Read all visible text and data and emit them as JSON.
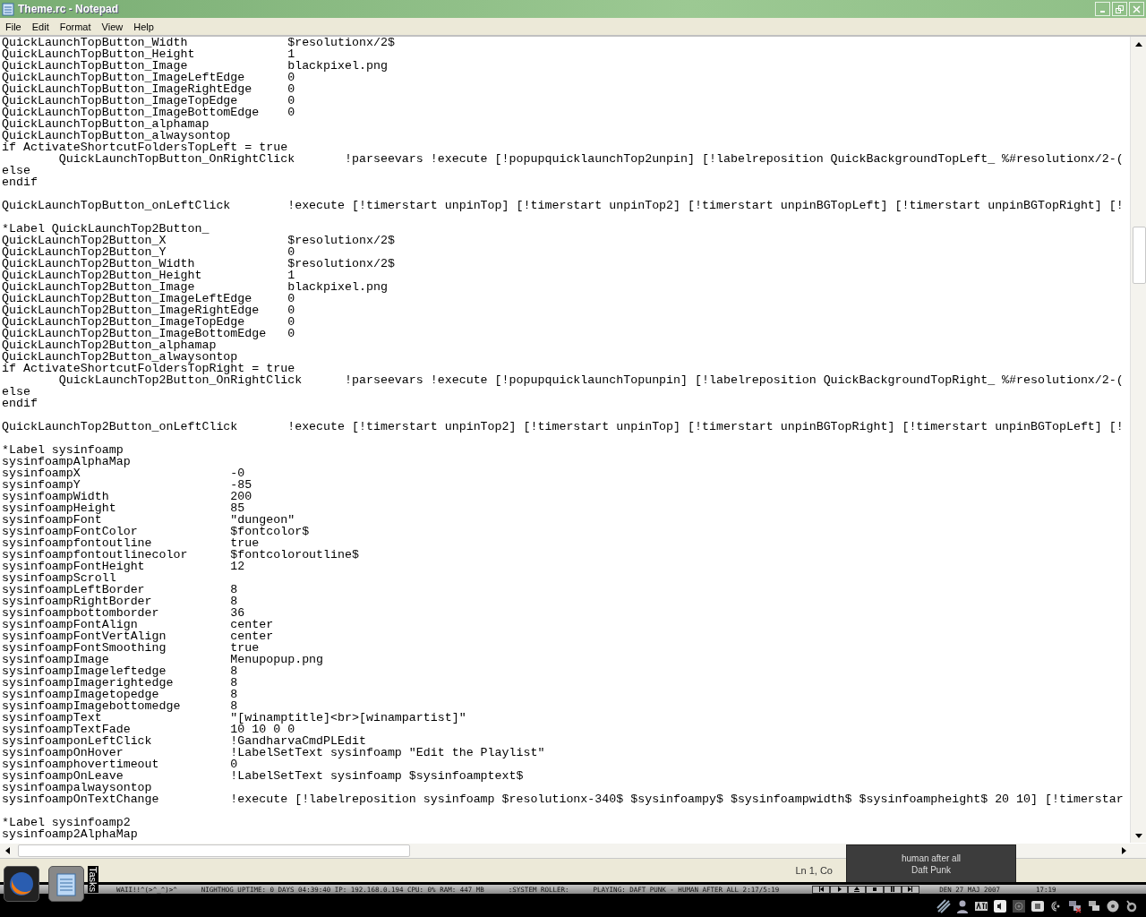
{
  "window": {
    "title": "Theme.rc - Notepad"
  },
  "menu": [
    "File",
    "Edit",
    "Format",
    "View",
    "Help"
  ],
  "document": {
    "blocks": [
      [
        "QuickLaunchTopButton_Width              $resolutionx/2$",
        "QuickLaunchTopButton_Height             1",
        "QuickLaunchTopButton_Image              blackpixel.png",
        "QuickLaunchTopButton_ImageLeftEdge      0",
        "QuickLaunchTopButton_ImageRightEdge     0",
        "QuickLaunchTopButton_ImageTopEdge       0",
        "QuickLaunchTopButton_ImageBottomEdge    0",
        "QuickLaunchTopButton_alphamap",
        "QuickLaunchTopButton_alwaysontop",
        "if ActivateShortcutFoldersTopLeft = true",
        "        QuickLaunchTopButton_OnRightClick       !parseevars !execute [!popupquicklaunchTop2unpin] [!labelreposition QuickBackgroundTopLeft_ %#resolutionx/2-(",
        "else",
        "endif"
      ],
      [
        "QuickLaunchTopButton_onLeftClick        !execute [!timerstart unpinTop] [!timerstart unpinTop2] [!timerstart unpinBGTopLeft] [!timerstart unpinBGTopRight] [!"
      ],
      [
        "*Label QuickLaunchTop2Button_",
        "QuickLaunchTop2Button_X                 $resolutionx/2$",
        "QuickLaunchTop2Button_Y                 0",
        "QuickLaunchTop2Button_Width             $resolutionx/2$",
        "QuickLaunchTop2Button_Height            1",
        "QuickLaunchTop2Button_Image             blackpixel.png",
        "QuickLaunchTop2Button_ImageLeftEdge     0",
        "QuickLaunchTop2Button_ImageRightEdge    0",
        "QuickLaunchTop2Button_ImageTopEdge      0",
        "QuickLaunchTop2Button_ImageBottomEdge   0",
        "QuickLaunchTop2Button_alphamap",
        "QuickLaunchTop2Button_alwaysontop",
        "if ActivateShortcutFoldersTopRight = true",
        "        QuickLaunchTop2Button_OnRightClick      !parseevars !execute [!popupquicklaunchTopunpin] [!labelreposition QuickBackgroundTopRight_ %#resolutionx/2-(",
        "else",
        "endif"
      ],
      [
        "QuickLaunchTop2Button_onLeftClick       !execute [!timerstart unpinTop2] [!timerstart unpinTop] [!timerstart unpinBGTopRight] [!timerstart unpinBGTopLeft] [!"
      ],
      [
        "*Label sysinfoamp",
        "sysinfoampAlphaMap",
        "sysinfoampX                     -0",
        "sysinfoampY                     -85",
        "sysinfoampWidth                 200",
        "sysinfoampHeight                85",
        "sysinfoampFont                  \"dungeon\"",
        "sysinfoampFontColor             $fontcolor$",
        "sysinfoampfontoutline           true",
        "sysinfoampfontoutlinecolor      $fontcoloroutline$",
        "sysinfoampFontHeight            12",
        "sysinfoampScroll",
        "sysinfoampLeftBorder            8",
        "sysinfoampRightBorder           8",
        "sysinfoampbottomborder          36",
        "sysinfoampFontAlign             center",
        "sysinfoampFontVertAlign         center",
        "sysinfoampFontSmoothing         true",
        "sysinfoampImage                 Menupopup.png",
        "sysinfoampImageleftedge         8",
        "sysinfoampImagerightedge        8",
        "sysinfoampImagetopedge          8",
        "sysinfoampImagebottomedge       8",
        "sysinfoampText                  \"[winamptitle]<br>[winampartist]\"",
        "sysinfoampTextFade              10 10 0 0",
        "sysinfoamponLeftClick           !GandharvaCmdPLEdit",
        "sysinfoampOnHover               !LabelSetText sysinfoamp \"Edit the Playlist\"",
        "sysinfoamphovertimeout          0",
        "sysinfoampOnLeave               !LabelSetText sysinfoamp $sysinfoamptext$",
        "sysinfoampalwaysontop",
        "sysinfoampOnTextChange          !execute [!labelreposition sysinfoamp $resolutionx-340$ $sysinfoampy$ $sysinfoampwidth$ $sysinfoampheight$ 20 10] [!timerstar"
      ],
      [
        "*Label sysinfoamp2",
        "sysinfoamp2AlphaMap"
      ]
    ]
  },
  "status_bar": {
    "position": "Ln 1, Co"
  },
  "notification": {
    "title": "human after all",
    "artist": "Daft Punk"
  },
  "taskbar": {
    "tasks_label": "Tasks",
    "ticker": [
      "WAII!!^(>^_^)>^",
      "NIGHTHOG UPTIME: 0 DAYS 04:39:40 IP: 192.168.0.194 CPU: 0% RAM: 447 MB",
      ":SYSTEM ROLLER:",
      "PLAYING: DAFT PUNK - HUMAN AFTER ALL 2:17/5:19"
    ],
    "date": "DEN 27 MAJ 2007",
    "time": "17:19"
  }
}
